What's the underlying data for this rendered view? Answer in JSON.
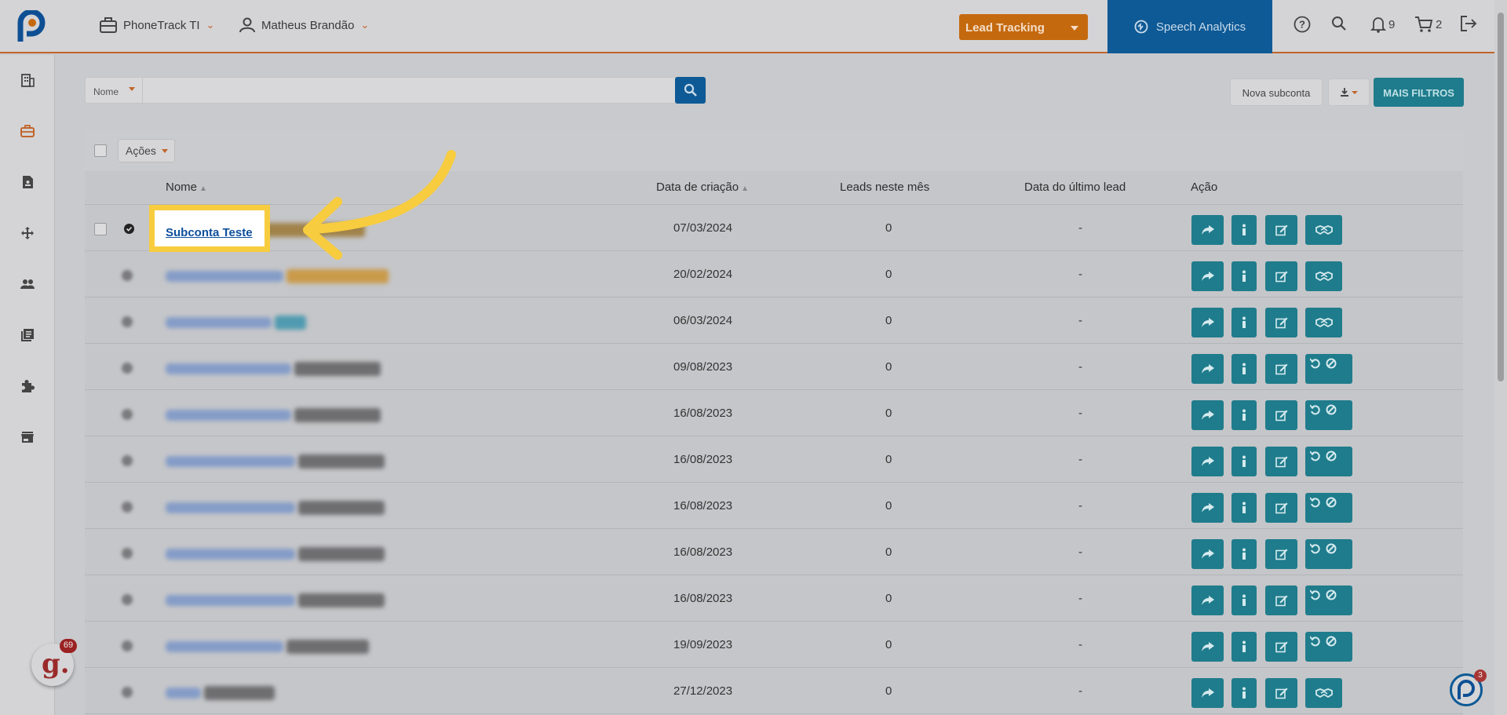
{
  "header": {
    "account": "PhoneTrack TI",
    "user": "Matheus Brandão",
    "product_select": "Lead Tracking",
    "speech_link": "Speech Analytics",
    "notifications_count": "9",
    "cart_count": "2"
  },
  "toolbar": {
    "search_field": "Nome",
    "search_value": "",
    "new_subaccount": "Nova subconta",
    "more_filters": "MAIS FILTROS",
    "actions_label": "Ações"
  },
  "table": {
    "columns": {
      "name": "Nome",
      "created": "Data de criação",
      "leads_month": "Leads neste mês",
      "last_lead": "Data do último lead",
      "action": "Ação"
    },
    "rows": [
      {
        "name": "Subconta Teste",
        "created": "07/03/2024",
        "leads": "0",
        "last_lead": "-",
        "last_action": "handshake"
      },
      {
        "name": "",
        "created": "20/02/2024",
        "leads": "0",
        "last_lead": "-",
        "last_action": "handshake"
      },
      {
        "name": "",
        "created": "06/03/2024",
        "leads": "0",
        "last_lead": "-",
        "last_action": "handshake"
      },
      {
        "name": "",
        "created": "09/08/2023",
        "leads": "0",
        "last_lead": "-",
        "last_action": "restore-block"
      },
      {
        "name": "",
        "created": "16/08/2023",
        "leads": "0",
        "last_lead": "-",
        "last_action": "restore-block"
      },
      {
        "name": "",
        "created": "16/08/2023",
        "leads": "0",
        "last_lead": "-",
        "last_action": "restore-block"
      },
      {
        "name": "",
        "created": "16/08/2023",
        "leads": "0",
        "last_lead": "-",
        "last_action": "restore-block"
      },
      {
        "name": "",
        "created": "16/08/2023",
        "leads": "0",
        "last_lead": "-",
        "last_action": "restore-block"
      },
      {
        "name": "",
        "created": "16/08/2023",
        "leads": "0",
        "last_lead": "-",
        "last_action": "restore-block"
      },
      {
        "name": "",
        "created": "19/09/2023",
        "leads": "0",
        "last_lead": "-",
        "last_action": "restore-block"
      },
      {
        "name": "",
        "created": "27/12/2023",
        "leads": "0",
        "last_lead": "-",
        "last_action": "handshake"
      }
    ]
  },
  "widgets": {
    "g_badge_count": "69",
    "chat_count": "3"
  },
  "colors": {
    "accent_orange": "#c5690f",
    "brand_blue": "#0e5a96",
    "action_teal": "#1f7c8c",
    "highlight_yellow": "#f7cc3f"
  }
}
